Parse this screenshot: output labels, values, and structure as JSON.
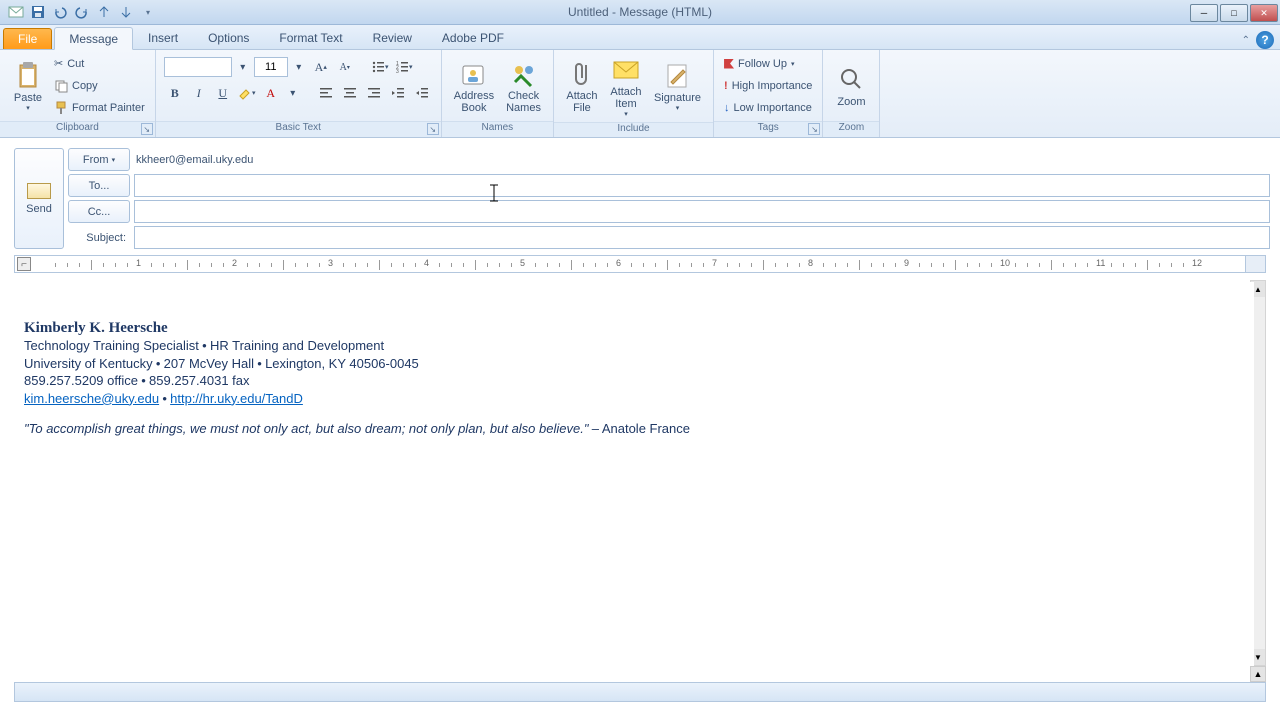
{
  "window": {
    "title": "Untitled - Message (HTML)"
  },
  "tabs": {
    "file": "File",
    "items": [
      "Message",
      "Insert",
      "Options",
      "Format Text",
      "Review",
      "Adobe PDF"
    ],
    "active": "Message"
  },
  "ribbon": {
    "clipboard": {
      "label": "Clipboard",
      "paste": "Paste",
      "cut": "Cut",
      "copy": "Copy",
      "format_painter": "Format Painter"
    },
    "basic_text": {
      "label": "Basic Text",
      "font": "",
      "size": "11"
    },
    "names": {
      "label": "Names",
      "address_book_l1": "Address",
      "address_book_l2": "Book",
      "check_l1": "Check",
      "check_l2": "Names"
    },
    "include": {
      "label": "Include",
      "attach_file_l1": "Attach",
      "attach_file_l2": "File",
      "attach_item_l1": "Attach",
      "attach_item_l2": "Item",
      "signature": "Signature"
    },
    "tags": {
      "label": "Tags",
      "follow_up": "Follow Up",
      "high": "High Importance",
      "low": "Low Importance"
    },
    "zoom": {
      "label": "Zoom",
      "zoom": "Zoom"
    }
  },
  "header": {
    "send": "Send",
    "from_btn": "From",
    "from_value": "kkheer0@email.uky.edu",
    "to_btn": "To...",
    "to_value": "",
    "cc_btn": "Cc...",
    "cc_value": "",
    "subject_lbl": "Subject:",
    "subject_value": ""
  },
  "ruler": {
    "numbers": [
      "1",
      "2",
      "3",
      "4",
      "5",
      "6",
      "7",
      "8",
      "9",
      "10",
      "11",
      "12"
    ]
  },
  "signature": {
    "name": "Kimberly K. Heersche",
    "role": "Technology Training Specialist",
    "dept": "HR Training and Development",
    "org": "University of Kentucky",
    "addr1": "207 McVey Hall",
    "addr2": "Lexington, KY 40506-0045",
    "phone": "859.257.5209 office",
    "fax": "859.257.4031 fax",
    "email": "kim.heersche@uky.edu",
    "url": "http://hr.uky.edu/TandD",
    "bullet": "•",
    "quote": "\"To accomplish great things, we must not only act, but also dream; not only plan, but also believe.\"",
    "attrib": "– Anatole France"
  }
}
